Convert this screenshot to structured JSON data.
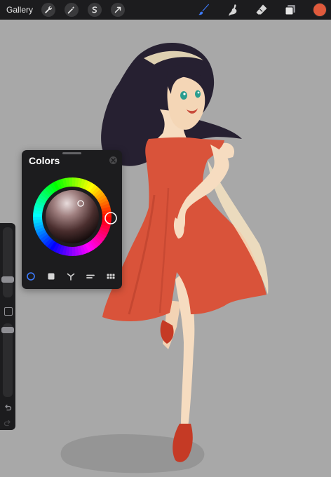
{
  "toolbar": {
    "gallery_label": "Gallery",
    "left_tools": [
      "wrench-icon",
      "magic-wand-icon",
      "selection-icon",
      "transform-arrow-icon"
    ],
    "right_tools": [
      "brush-icon",
      "smudge-icon",
      "eraser-icon",
      "layers-icon"
    ],
    "current_color": "#e05a3c",
    "active_tool_color": "#3d7bfd"
  },
  "sidebar": {
    "brush_size_level": 0.26,
    "opacity_level": 0.05
  },
  "colors_panel": {
    "title": "Colors",
    "primary_color": "#e05a3c",
    "modes": [
      "disc",
      "classic",
      "harmony",
      "value",
      "palettes"
    ],
    "active_mode": "disc"
  }
}
